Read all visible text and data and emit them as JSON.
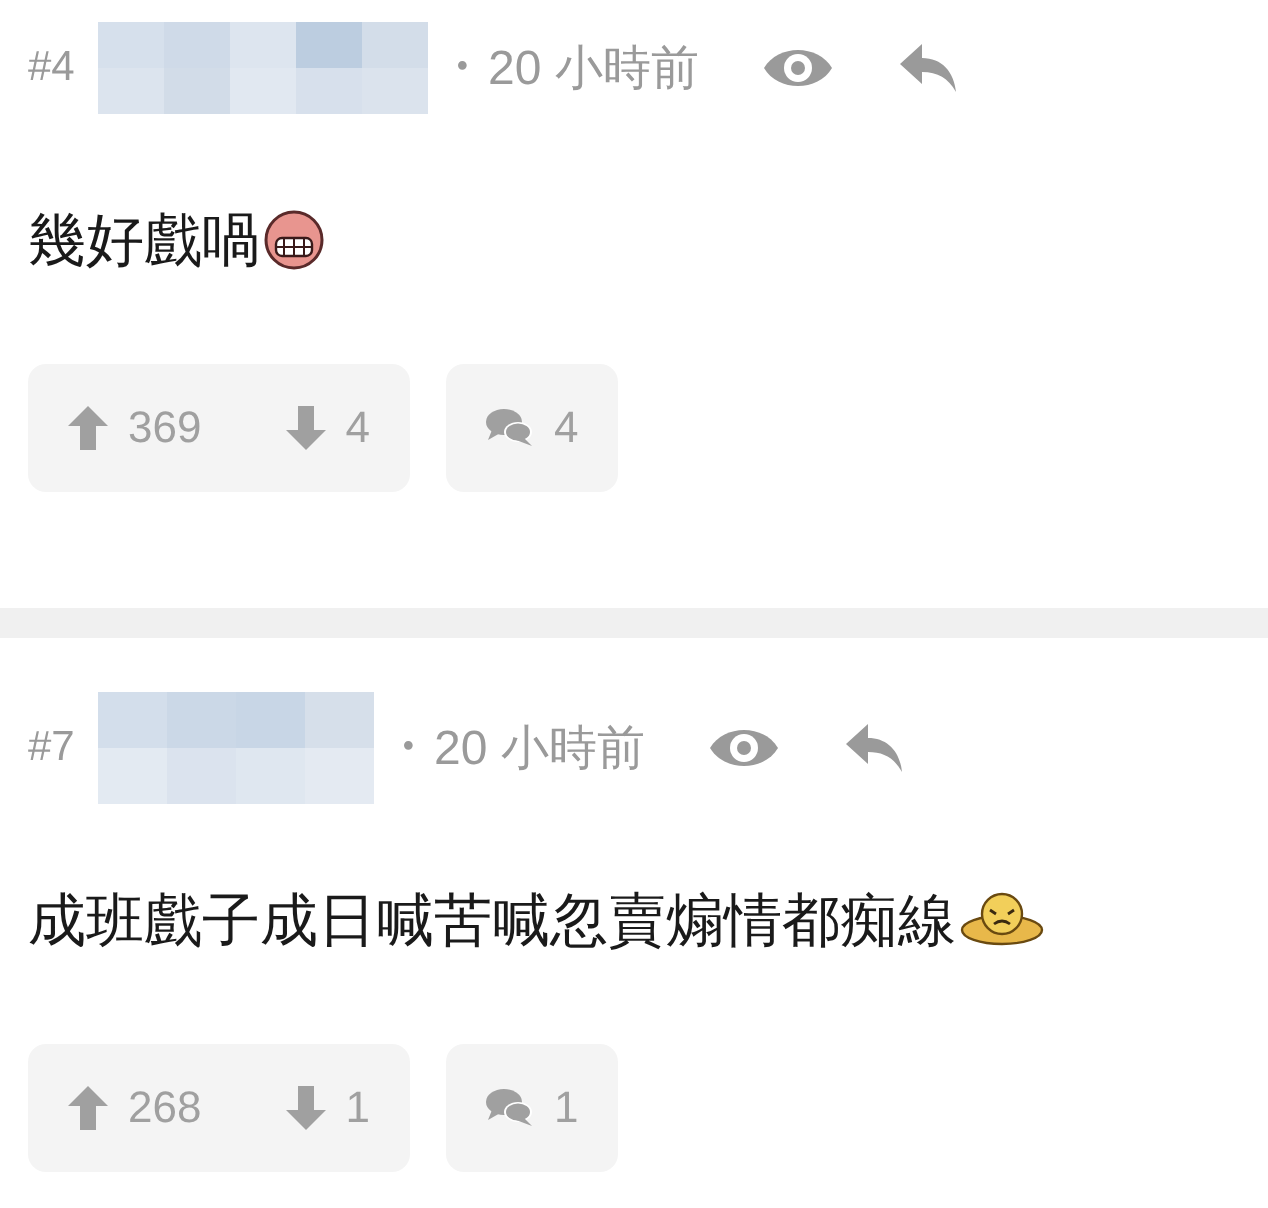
{
  "posts": [
    {
      "number": "#4",
      "author": {
        "kind": "redacted"
      },
      "time": "20 小時前",
      "separator": "•",
      "body": "幾好戲喎",
      "upvotes": "369",
      "downvotes": "4",
      "replies": "4"
    },
    {
      "number": "#7",
      "author": {
        "kind": "redacted"
      },
      "time": "20 小時前",
      "separator": "•",
      "body": "成班戲子成日喊苦喊忽賣煽情都痴線",
      "upvotes": "268",
      "downvotes": "1",
      "replies": "1"
    }
  ]
}
